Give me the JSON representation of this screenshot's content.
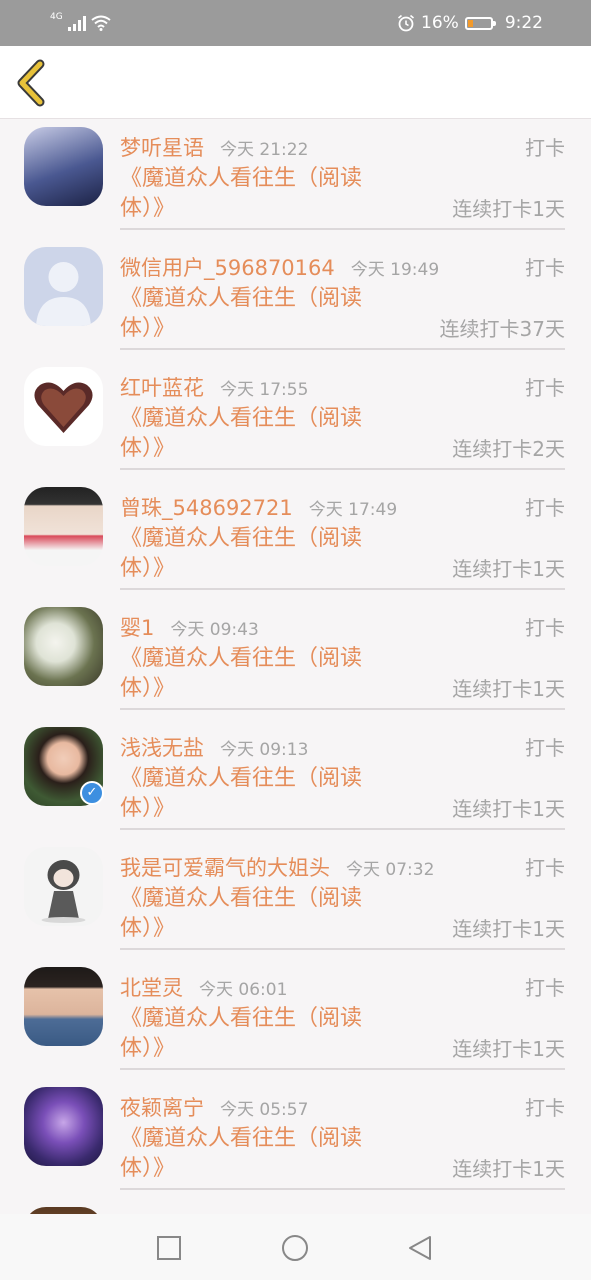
{
  "status_bar": {
    "network": "4G",
    "battery_percent": "16%",
    "time": "9:22"
  },
  "items": [
    {
      "name": "梦听星语",
      "time": "今天 21:22",
      "type": "打卡",
      "book": "《魔道众人看往生（阅读体）》",
      "streak": "连续打卡1天",
      "avatar_bg": "#6d7aa8",
      "verified": false
    },
    {
      "name": "微信用户_596870164",
      "time": "今天 19:49",
      "type": "打卡",
      "book": "《魔道众人看往生（阅读体）》",
      "streak": "连续打卡37天",
      "avatar_bg": "#ccd4e8",
      "verified": false
    },
    {
      "name": "红叶蓝花",
      "time": "今天 17:55",
      "type": "打卡",
      "book": "《魔道众人看往生（阅读体）》",
      "streak": "连续打卡2天",
      "avatar_bg": "#ffffff",
      "verified": false
    },
    {
      "name": "曾珠_548692721",
      "time": "今天 17:49",
      "type": "打卡",
      "book": "《魔道众人看往生（阅读体）》",
      "streak": "连续打卡1天",
      "avatar_bg": "#d9c9c2",
      "verified": false
    },
    {
      "name": "婴1",
      "time": "今天 09:43",
      "type": "打卡",
      "book": "《魔道众人看往生（阅读体）》",
      "streak": "连续打卡1天",
      "avatar_bg": "#6e6a4f",
      "verified": false
    },
    {
      "name": "浅浅无盐",
      "time": "今天 09:13",
      "type": "打卡",
      "book": "《魔道众人看往生（阅读体）》",
      "streak": "连续打卡1天",
      "avatar_bg": "#3f5a34",
      "verified": true
    },
    {
      "name": "我是可爱霸气的大姐头",
      "time": "今天 07:32",
      "type": "打卡",
      "book": "《魔道众人看往生（阅读体）》",
      "streak": "连续打卡1天",
      "avatar_bg": "#ececec",
      "verified": false
    },
    {
      "name": "北堂灵",
      "time": "今天 06:01",
      "type": "打卡",
      "book": "《魔道众人看往生（阅读体）》",
      "streak": "连续打卡1天",
      "avatar_bg": "#5a6a86",
      "verified": false
    },
    {
      "name": "夜颖离宁",
      "time": "今天 05:57",
      "type": "打卡",
      "book": "《魔道众人看往生（阅读体）》",
      "streak": "连续打卡1天",
      "avatar_bg": "#5a3f86",
      "verified": false
    }
  ],
  "colors": {
    "accent": "#e58d5a",
    "muted": "#a5a5a5",
    "back_chevron": "#e8c23a"
  }
}
